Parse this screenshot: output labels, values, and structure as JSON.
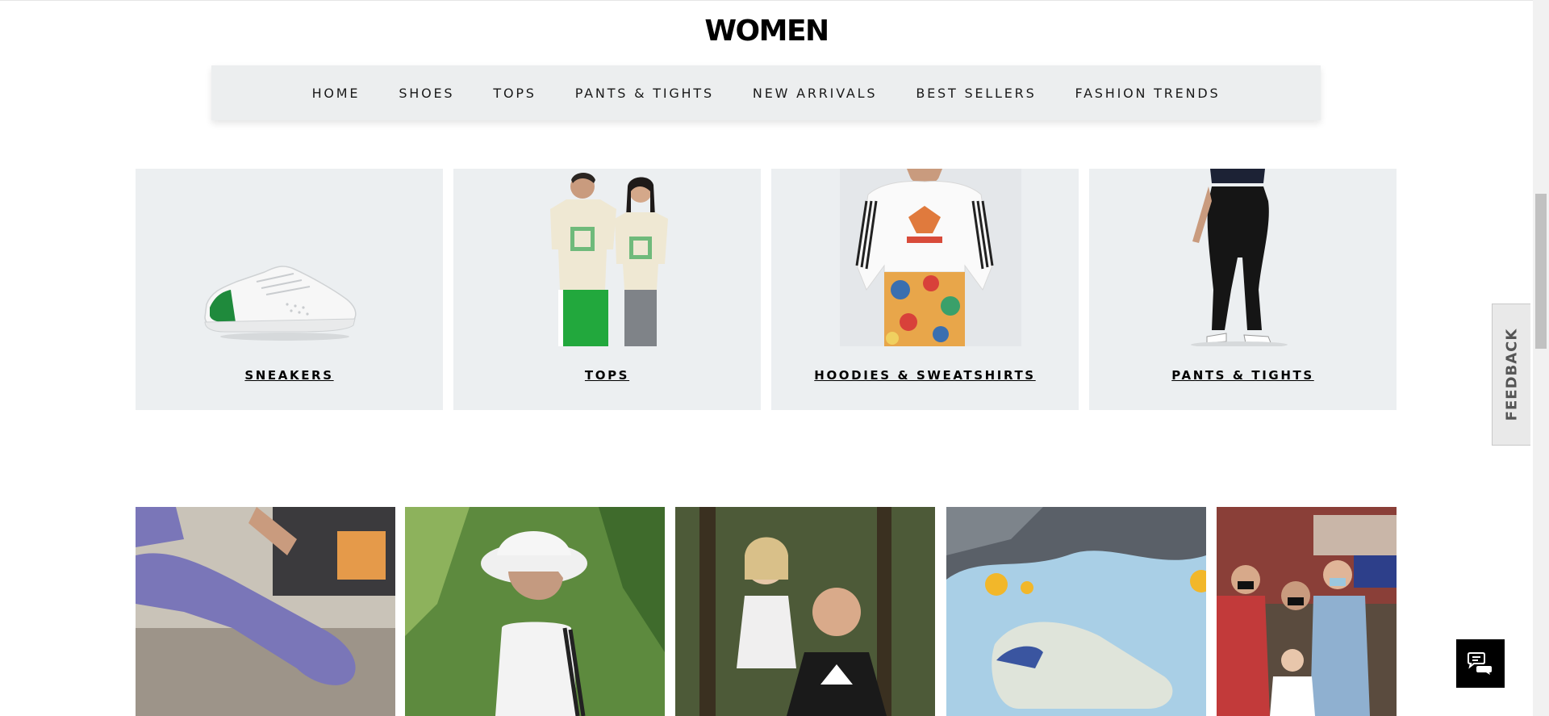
{
  "page": {
    "title": "WOMEN"
  },
  "nav": {
    "items": [
      "HOME",
      "SHOES",
      "TOPS",
      "PANTS & TIGHTS",
      "NEW ARRIVALS",
      "BEST SELLERS",
      "FASHION TRENDS"
    ]
  },
  "categories": [
    {
      "label": "SNEAKERS",
      "icon": "sneaker-image"
    },
    {
      "label": "TOPS",
      "icon": "tops-models-image"
    },
    {
      "label": "HOODIES & SWEATSHIRTS",
      "icon": "hoodie-model-image"
    },
    {
      "label": "PANTS & TIGHTS",
      "icon": "leggings-model-image"
    }
  ],
  "tiles": [
    {
      "icon": "yoga-leggings-photo"
    },
    {
      "icon": "bucket-hat-model-photo"
    },
    {
      "icon": "father-daughter-photo"
    },
    {
      "icon": "floating-sneaker-photo"
    },
    {
      "icon": "group-masks-photo"
    }
  ],
  "feedback": {
    "label": "FEEDBACK"
  },
  "chat": {
    "icon": "chat-bubbles-icon"
  },
  "colors": {
    "nav_bg": "#eceeef",
    "card_bg": "#eceff1",
    "text": "#000000"
  }
}
